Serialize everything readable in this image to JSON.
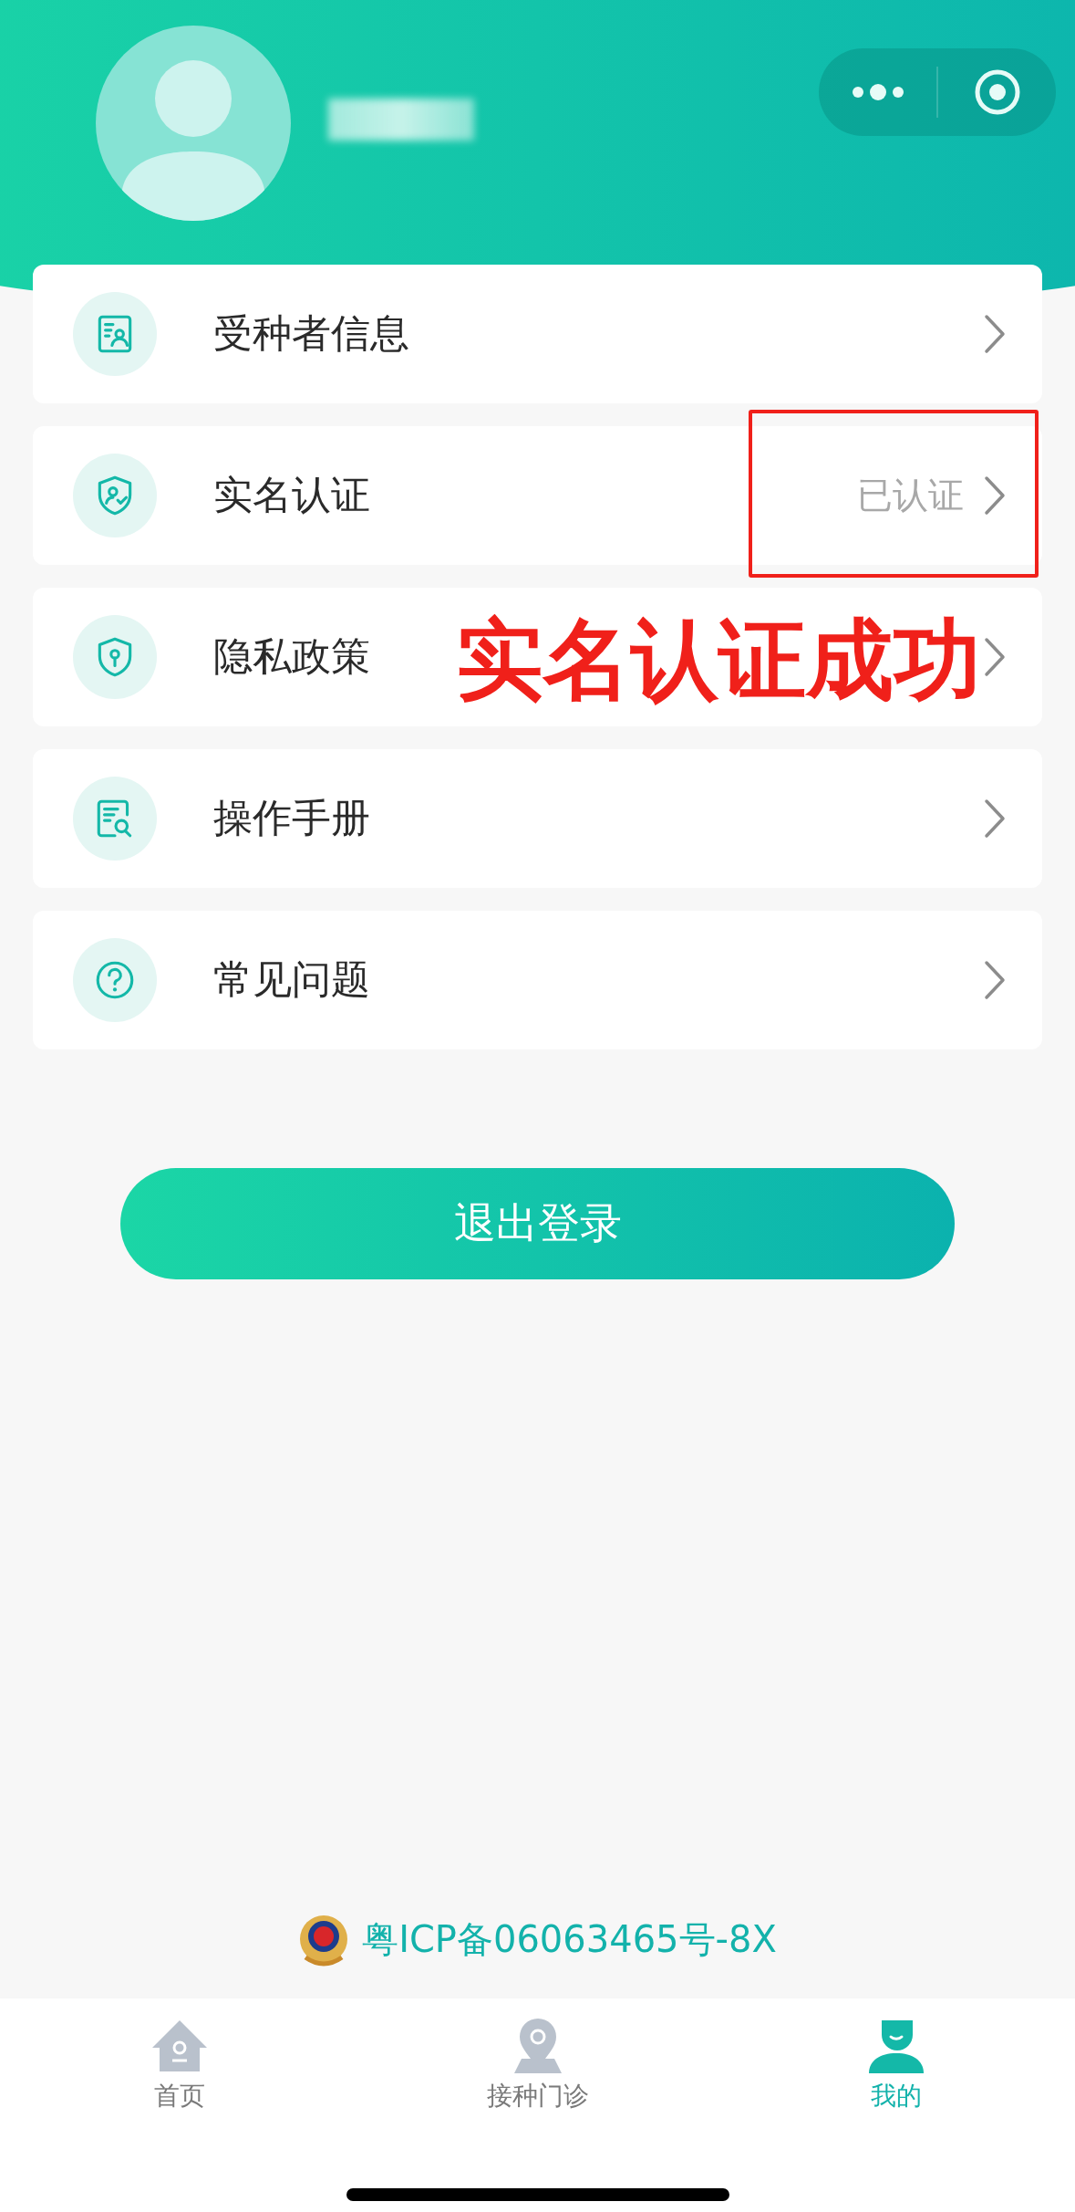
{
  "menu": [
    {
      "kind": "person-card",
      "label": "受种者信息"
    },
    {
      "kind": "shield-person",
      "label": "实名认证",
      "value": "已认证"
    },
    {
      "kind": "shield-key",
      "label": "隐私政策"
    },
    {
      "kind": "manual",
      "label": "操作手册"
    },
    {
      "kind": "question",
      "label": "常见问题"
    }
  ],
  "annotation": {
    "text": "实名认证成功"
  },
  "logout_button": "退出登录",
  "icp": "粤ICP备06063465号-8X",
  "tabs": [
    {
      "kind": "home",
      "label": "首页",
      "selected": false
    },
    {
      "kind": "clinic",
      "label": "接种门诊",
      "selected": false
    },
    {
      "kind": "me",
      "label": "我的",
      "selected": true
    }
  ]
}
